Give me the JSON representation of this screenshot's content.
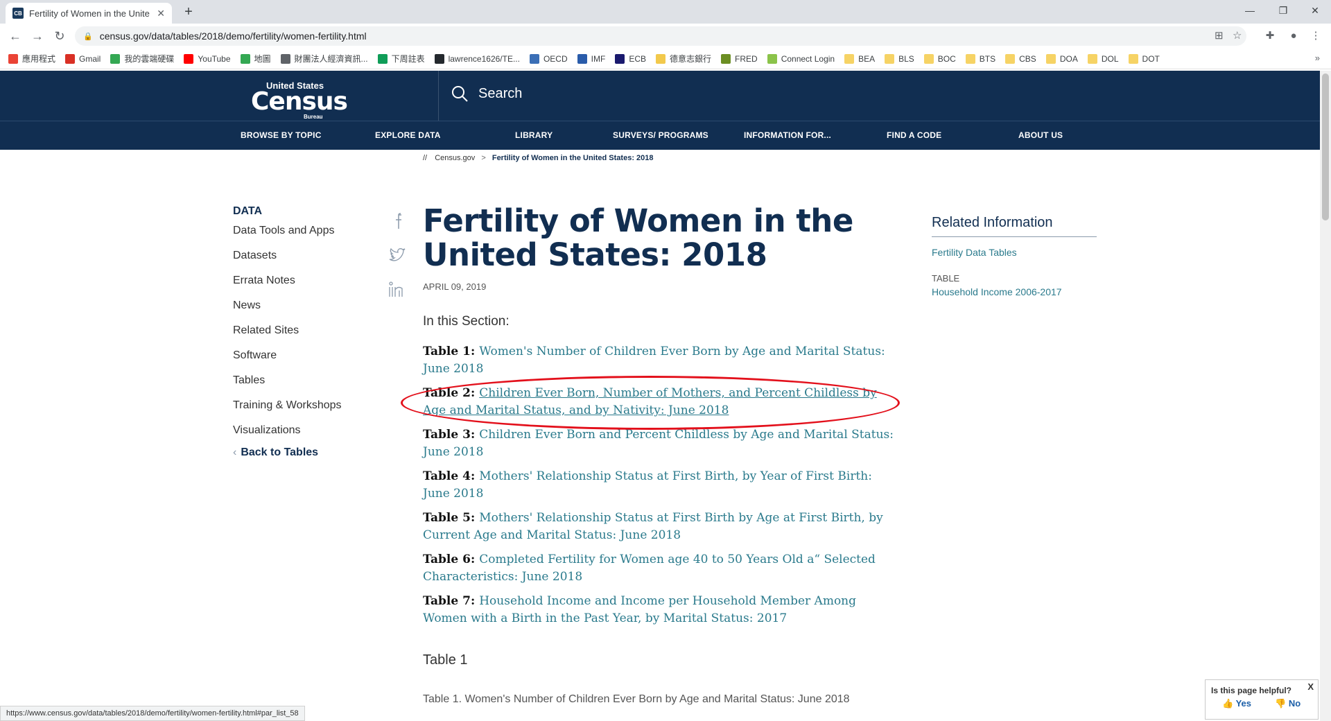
{
  "browser": {
    "tab_title": "Fertility of Women in the Unite",
    "favicon_text": "CB",
    "url": "census.gov/data/tables/2018/demo/fertility/women-fertility.html",
    "bookmarks": [
      {
        "label": "應用程式",
        "color": "#ea4335"
      },
      {
        "label": "Gmail",
        "color": "#d93025"
      },
      {
        "label": "我的雲端硬碟",
        "color": "#34a853"
      },
      {
        "label": "YouTube",
        "color": "#ff0000"
      },
      {
        "label": "地圖",
        "color": "#34a853"
      },
      {
        "label": "財團法人經濟資訊...",
        "color": "#5f6368"
      },
      {
        "label": "下周註表",
        "color": "#0f9d58"
      },
      {
        "label": "lawrence1626/TE...",
        "color": "#24292e"
      },
      {
        "label": "OECD",
        "color": "#3b6fb6"
      },
      {
        "label": "IMF",
        "color": "#2a5caa"
      },
      {
        "label": "ECB",
        "color": "#1a1a6e"
      },
      {
        "label": "德意志銀行",
        "color": "#f2c94c"
      },
      {
        "label": "FRED",
        "color": "#6b8e23"
      },
      {
        "label": "Connect Login",
        "color": "#8bc34a"
      },
      {
        "label": "BEA",
        "color": "#f6d365"
      },
      {
        "label": "BLS",
        "color": "#f6d365"
      },
      {
        "label": "BOC",
        "color": "#f6d365"
      },
      {
        "label": "BTS",
        "color": "#f6d365"
      },
      {
        "label": "CBS",
        "color": "#f6d365"
      },
      {
        "label": "DOA",
        "color": "#f6d365"
      },
      {
        "label": "DOL",
        "color": "#f6d365"
      },
      {
        "label": "DOT",
        "color": "#f6d365"
      }
    ],
    "status_url": "https://www.census.gov/data/tables/2018/demo/fertility/women-fertility.html#par_list_58"
  },
  "header": {
    "logo_top": "United States",
    "logo_main": "Census",
    "logo_sub": "Bureau",
    "search_label": "Search",
    "nav": [
      "BROWSE BY TOPIC",
      "EXPLORE DATA",
      "LIBRARY",
      "SURVEYS/ PROGRAMS",
      "INFORMATION FOR...",
      "FIND A CODE",
      "ABOUT US"
    ]
  },
  "breadcrumb": {
    "prefix": "//",
    "home": "Census.gov",
    "sep": ">",
    "current": "Fertility of Women in the United States: 2018"
  },
  "sidebar": {
    "heading": "DATA",
    "items": [
      "Data Tools and Apps",
      "Datasets",
      "Errata Notes",
      "News",
      "Related Sites",
      "Software",
      "Tables",
      "Training & Workshops",
      "Visualizations"
    ],
    "back": "Back to Tables"
  },
  "main": {
    "title": "Fertility of Women in the United States: 2018",
    "date": "APRIL 09, 2019",
    "section_heading": "In this Section:",
    "tables": [
      {
        "label": "Table 1:",
        "text": "Women's Number of Children Ever Born by Age and Marital Status: June 2018"
      },
      {
        "label": "Table 2:",
        "text": "Children Ever Born, Number of Mothers, and Percent Childless by Age and Marital Status, and by Nativity: June 2018"
      },
      {
        "label": "Table 3:",
        "text": "Children Ever Born and Percent Childless by Age and Marital Status: June 2018"
      },
      {
        "label": "Table 4:",
        "text": "Mothers' Relationship Status at First Birth, by Year of First Birth: June 2018"
      },
      {
        "label": "Table 5:",
        "text": "Mothers' Relationship Status at First Birth by Age at First Birth, by Current Age and Marital Status: June 2018"
      },
      {
        "label": "Table 6:",
        "text": "Completed Fertility for Women age 40 to 50 Years Old a“ Selected Characteristics: June 2018"
      },
      {
        "label": "Table 7:",
        "text": "Household Income and Income per Household Member Among Women with a Birth in the Past Year, by Marital Status: 2017"
      }
    ],
    "table1_heading": "Table 1",
    "table1_desc": "Table 1. Women's Number of Children Ever Born by Age and Marital Status: June 2018"
  },
  "related": {
    "heading": "Related Information",
    "link1": "Fertility Data Tables",
    "type_label": "TABLE",
    "link2": "Household Income 2006-2017"
  },
  "feedback": {
    "question": "Is this page helpful?",
    "yes": "Yes",
    "no": "No",
    "close": "X"
  }
}
